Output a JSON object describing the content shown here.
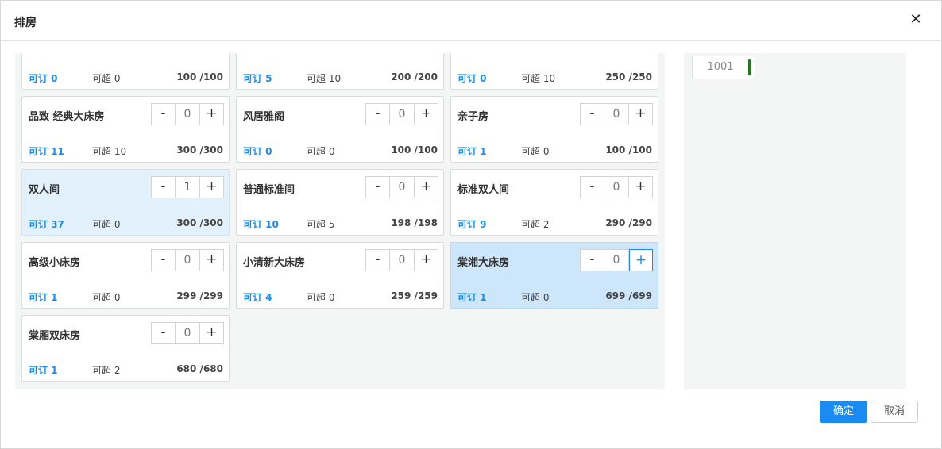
{
  "dialog": {
    "title": "排房",
    "close_label": "✕"
  },
  "stepper": {
    "minus": "-",
    "plus": "+"
  },
  "rooms": [
    {
      "name": "",
      "qty": "",
      "bookable": "可订 0",
      "over": "可超 0",
      "ratio": "100 /100"
    },
    {
      "name": "",
      "qty": "",
      "bookable": "可订 5",
      "over": "可超 10",
      "ratio": "200 /200"
    },
    {
      "name": "",
      "qty": "",
      "bookable": "可订 0",
      "over": "可超 10",
      "ratio": "250 /250"
    },
    {
      "name": "品致 经典大床房",
      "qty": "0",
      "bookable": "可订 11",
      "over": "可超 10",
      "ratio": "300 /300"
    },
    {
      "name": "风居雅阁",
      "qty": "0",
      "bookable": "可订 0",
      "over": "可超 0",
      "ratio": "100 /100"
    },
    {
      "name": "亲子房",
      "qty": "0",
      "bookable": "可订 1",
      "over": "可超 0",
      "ratio": "100 /100"
    },
    {
      "name": "双人间",
      "qty": "1",
      "bookable": "可订 37",
      "over": "可超 0",
      "ratio": "300 /300"
    },
    {
      "name": "普通标准间",
      "qty": "0",
      "bookable": "可订 10",
      "over": "可超 5",
      "ratio": "198 /198"
    },
    {
      "name": "标准双人间",
      "qty": "0",
      "bookable": "可订 9",
      "over": "可超 2",
      "ratio": "290 /290"
    },
    {
      "name": "高级小床房",
      "qty": "0",
      "bookable": "可订 1",
      "over": "可超 0",
      "ratio": "299 /299"
    },
    {
      "name": "小清新大床房",
      "qty": "0",
      "bookable": "可订 4",
      "over": "可超 0",
      "ratio": "259 /259"
    },
    {
      "name": "棠湘大床房",
      "qty": "0",
      "bookable": "可订 1",
      "over": "可超 0",
      "ratio": "699 /699"
    },
    {
      "name": "棠厢双床房",
      "qty": "0",
      "bookable": "可订 1",
      "over": "可超 2",
      "ratio": "680 /680"
    }
  ],
  "assigned": {
    "room_number": "1001",
    "status_color": "#1d7a1d"
  },
  "footer": {
    "ok_label": "确定",
    "cancel_label": "取消"
  },
  "colors": {
    "accent": "#1a8bf0",
    "selected_bg": "#e3f1fc",
    "active_bg": "#cde6fa"
  }
}
